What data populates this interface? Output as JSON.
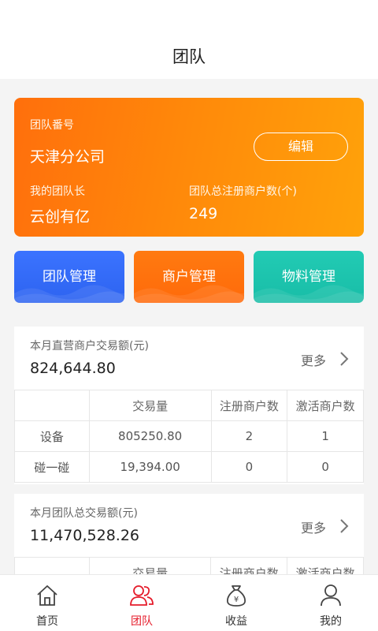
{
  "header": {
    "title": "团队"
  },
  "team": {
    "id_label": "团队番号",
    "id_value": "天津分公司",
    "edit_label": "编辑",
    "leader_label": "我的团队长",
    "leader_value": "云创有亿",
    "merchants_label": "团队总注册商户数(个)",
    "merchants_value": "249"
  },
  "actions": [
    {
      "label": "团队管理",
      "color": "#2f66f5"
    },
    {
      "label": "商户管理",
      "color": "#ff6e0c"
    },
    {
      "label": "物料管理",
      "color": "#1cc3ad"
    }
  ],
  "direct": {
    "caption": "本月直营商户交易额(元)",
    "amount": "824,644.80",
    "more": "更多",
    "headers": [
      "",
      "交易量",
      "注册商户数",
      "激活商户数"
    ],
    "rows": [
      [
        "设备",
        "805250.80",
        "2",
        "1"
      ],
      [
        "碰一碰",
        "19,394.00",
        "0",
        "0"
      ]
    ]
  },
  "team_total": {
    "caption": "本月团队总交易额(元)",
    "amount": "11,470,528.26",
    "more": "更多",
    "headers": [
      "",
      "交易量",
      "注册商户数",
      "激活商户数"
    ]
  },
  "tabbar": {
    "active_color": "#e51b2a",
    "items": [
      {
        "label": "首页",
        "icon": "home-icon"
      },
      {
        "label": "团队",
        "icon": "team-icon"
      },
      {
        "label": "收益",
        "icon": "money-bag-icon"
      },
      {
        "label": "我的",
        "icon": "user-icon"
      }
    ]
  }
}
